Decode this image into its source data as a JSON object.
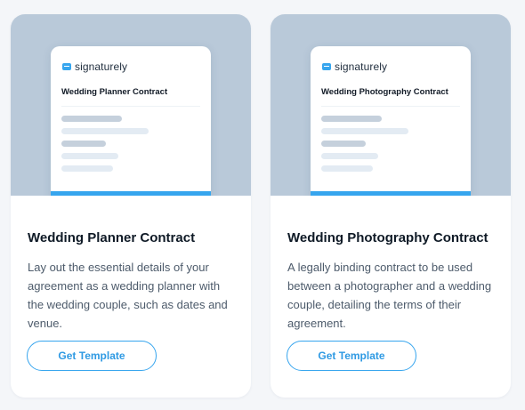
{
  "brand": {
    "name": "signaturely",
    "accent_color": "#36a5ee",
    "preview_bg_color": "#b9c9d9",
    "icon": "signaturely-logo-icon"
  },
  "cards": [
    {
      "preview_doc_title": "Wedding Planner Contract",
      "title": "Wedding Planner Contract",
      "description": "Lay out the essential details of your agreement as a wedding planner with the wedding couple, such as dates and venue.",
      "button_label": "Get Template"
    },
    {
      "preview_doc_title": "Wedding Photography Contract",
      "title": "Wedding Photography Contract",
      "description": "A legally binding contract to be used between a photographer and a wedding couple, detailing the terms of their agreement.",
      "button_label": "Get Template"
    }
  ]
}
